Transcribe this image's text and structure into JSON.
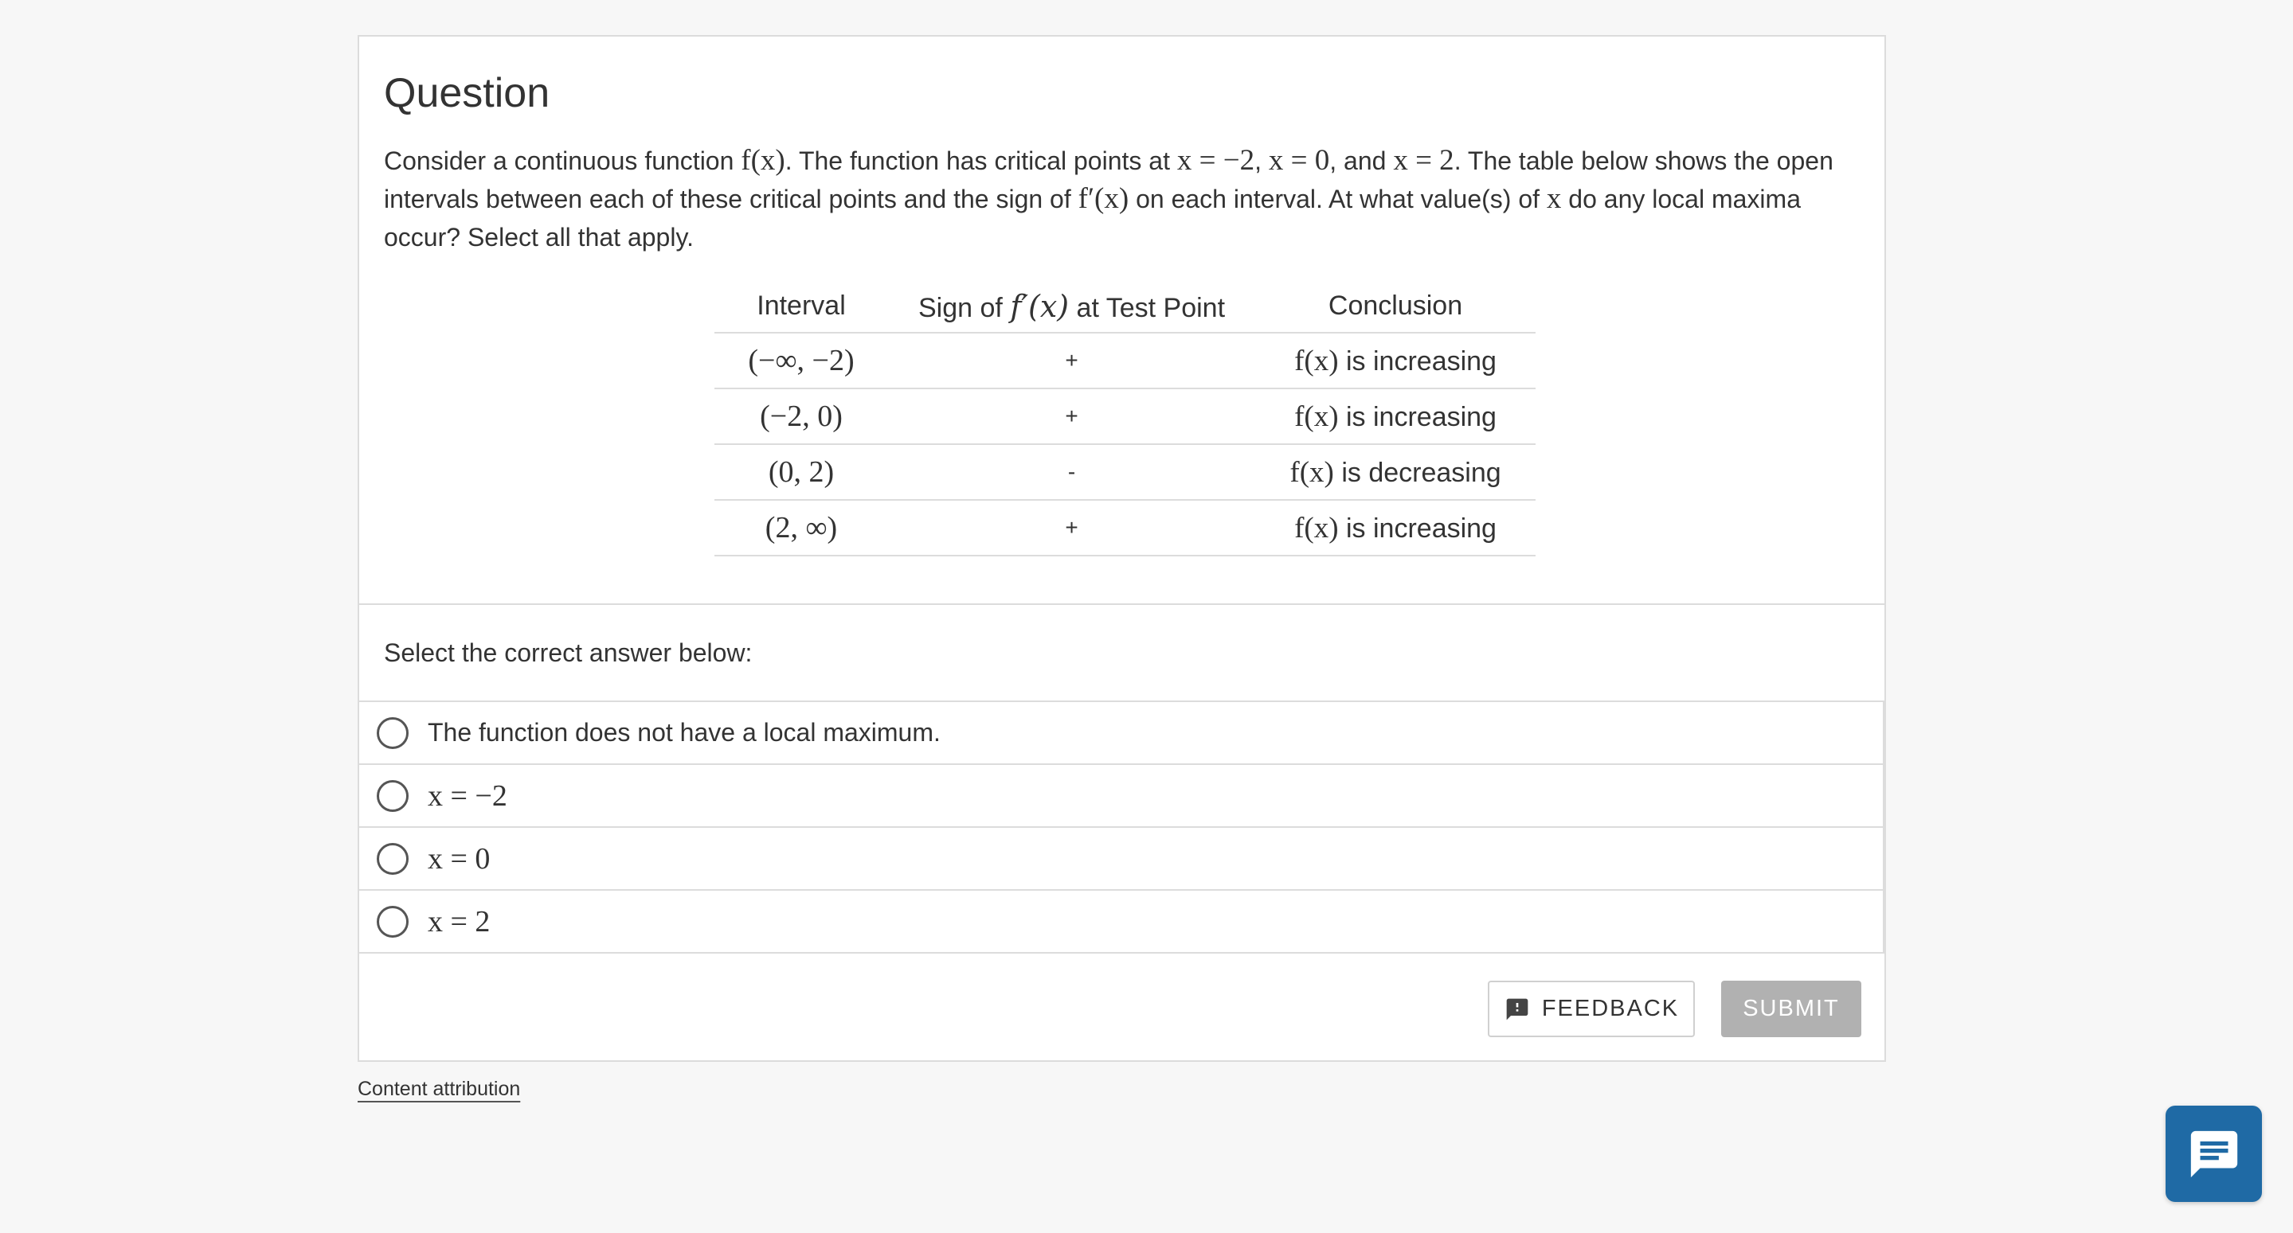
{
  "question": {
    "heading": "Question",
    "body": {
      "t1": "Consider a continuous function ",
      "m1": "f(x)",
      "t2": ". The function has critical points at ",
      "m2": "x = −2",
      "t3": ", ",
      "m3": "x = 0",
      "t4": ", and ",
      "m4": "x = 2",
      "t5": ". The table below shows the open intervals between each of these critical points and the sign of ",
      "m5": "f′(x)",
      "t6": " on each interval. At what value(s) of ",
      "m6": "x",
      "t7": " do any local maxima occur? Select all that apply."
    }
  },
  "table": {
    "headers": {
      "interval": "Interval",
      "sign_prefix": "Sign of ",
      "sign_math": "f′(x)",
      "sign_suffix": " at Test Point",
      "conclusion": "Conclusion"
    },
    "rows": [
      {
        "interval": "(−∞, −2)",
        "sign": "+",
        "conclusion_math": "f(x)",
        "conclusion_text": " is increasing"
      },
      {
        "interval": "(−2, 0)",
        "sign": "+",
        "conclusion_math": "f(x)",
        "conclusion_text": " is increasing"
      },
      {
        "interval": "(0, 2)",
        "sign": "-",
        "conclusion_math": "f(x)",
        "conclusion_text": " is decreasing"
      },
      {
        "interval": "(2, ∞)",
        "sign": "+",
        "conclusion_math": "f(x)",
        "conclusion_text": " is increasing"
      }
    ]
  },
  "answers": {
    "prompt": "Select the correct answer below:",
    "options": [
      "The function does not have a local maximum.",
      "x = −2",
      "x = 0",
      "x = 2"
    ]
  },
  "buttons": {
    "feedback_label": "FEEDBACK",
    "feedback_icon": "feedback-icon",
    "submit_label": "SUBMIT"
  },
  "footer": {
    "attribution": "Content attribution"
  },
  "chat": {
    "icon": "chat-icon"
  },
  "colors": {
    "chat_button": "#1f6aa5",
    "submit_disabled": "#b1b1b1",
    "border": "#dcdcdc",
    "text": "#333333"
  }
}
